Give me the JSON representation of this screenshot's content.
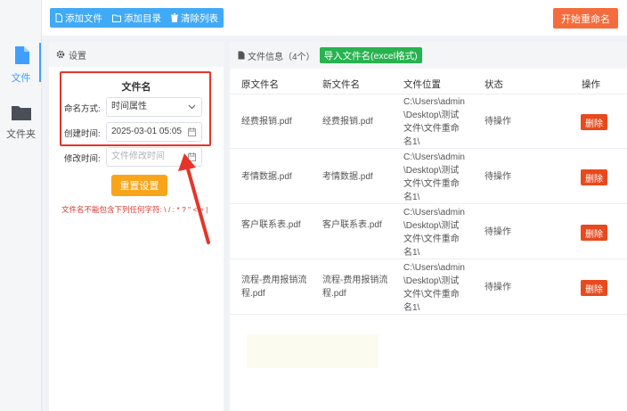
{
  "leftnav": {
    "items": [
      {
        "label": "文件",
        "icon": "file-icon",
        "active": true
      },
      {
        "label": "文件夹",
        "icon": "folder-icon",
        "active": false
      }
    ]
  },
  "toolbar": {
    "add_file": "添加文件",
    "add_folder": "添加目录",
    "clear_list": "清除列表",
    "start_rename": "开始重命名",
    "colors": {
      "primary": "#40aaf7",
      "start": "#f56c3c"
    }
  },
  "settings": {
    "header": "设置",
    "section_title": "文件名",
    "naming_label": "命名方式:",
    "naming_value": "时间属性",
    "created_label": "创建时间:",
    "created_value": "2025-03-01 05:05",
    "modified_label": "修改时间:",
    "modified_placeholder": "文件修改时间",
    "reset_button": "重置设置",
    "warning": "文件名不能包含下列任何字符: \\ / : * ? \" < > |"
  },
  "fileinfo": {
    "header": "文件信息",
    "count": "（4个）",
    "import_button": "导入文件名(excel格式)",
    "columns": [
      "原文件名",
      "新文件名",
      "文件位置",
      "状态",
      "操作"
    ],
    "rows": [
      {
        "orig": "经费报销.pdf",
        "new": "经费报销.pdf",
        "path": "C:\\Users\\admin\\Desktop\\测试文件\\文件重命名1\\",
        "status": "待操作",
        "action": "删除"
      },
      {
        "orig": "考情数据.pdf",
        "new": "考情数据.pdf",
        "path": "C:\\Users\\admin\\Desktop\\测试文件\\文件重命名1\\",
        "status": "待操作",
        "action": "删除"
      },
      {
        "orig": "客户联系表.pdf",
        "new": "客户联系表.pdf",
        "path": "C:\\Users\\admin\\Desktop\\测试文件\\文件重命名1\\",
        "status": "待操作",
        "action": "删除"
      },
      {
        "orig": "流程-费用报销流程.pdf",
        "new": "流程-费用报销流程.pdf",
        "path": "C:\\Users\\admin\\Desktop\\测试文件\\文件重命名1\\",
        "status": "待操作",
        "action": "删除"
      }
    ]
  },
  "annotation_color": "#e5352a"
}
